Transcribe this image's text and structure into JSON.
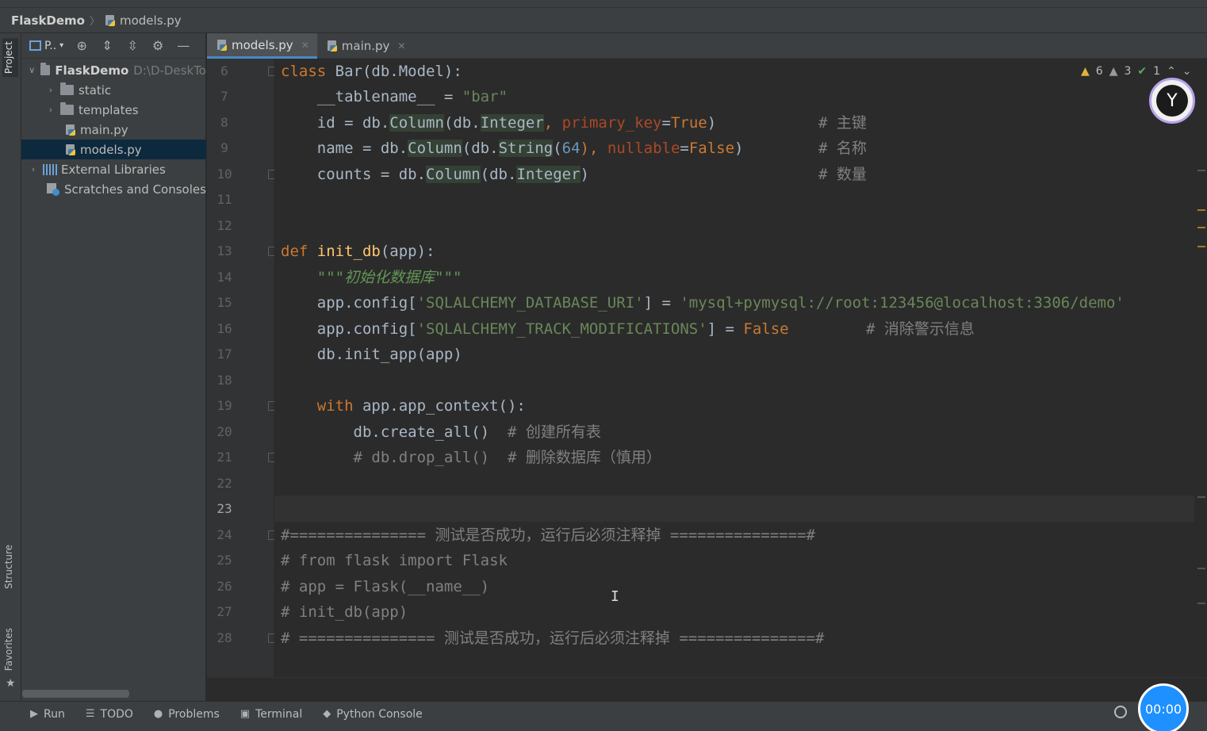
{
  "breadcrumb": {
    "project": "FlaskDemo",
    "file": "models.py"
  },
  "sidestrip": {
    "project": "Project",
    "structure": "Structure",
    "favorites": "Favorites"
  },
  "project_panel": {
    "title": "P..",
    "tree": [
      {
        "label": "FlaskDemo",
        "path": "D:\\D-DeskTo",
        "kind": "root"
      },
      {
        "label": "static",
        "kind": "folder"
      },
      {
        "label": "templates",
        "kind": "folder"
      },
      {
        "label": "main.py",
        "kind": "py"
      },
      {
        "label": "models.py",
        "kind": "py",
        "selected": true
      },
      {
        "label": "External Libraries",
        "kind": "lib"
      },
      {
        "label": "Scratches and Consoles",
        "kind": "scratch"
      }
    ]
  },
  "tabs": [
    {
      "label": "models.py",
      "active": true
    },
    {
      "label": "main.py",
      "active": false
    }
  ],
  "inspections": {
    "warnings": "6",
    "weak": "3",
    "ok": "1"
  },
  "line_numbers": [
    "6",
    "7",
    "8",
    "9",
    "10",
    "11",
    "12",
    "13",
    "14",
    "15",
    "16",
    "17",
    "18",
    "19",
    "20",
    "21",
    "22",
    "23",
    "24",
    "25",
    "26",
    "27",
    "28"
  ],
  "code": {
    "l6": {
      "kw": "class",
      "name": " Bar(db.Model):"
    },
    "l7": {
      "a": "    __tablename__ = ",
      "s": "\"bar\""
    },
    "l8": {
      "a": "    id = db.",
      "h1": "Column",
      "b": "(db.",
      "h2": "Integer",
      "c": ", ",
      "p": "primary_key",
      "d": "=",
      "k": "True",
      "e": ")",
      "cm": "# 主键"
    },
    "l9": {
      "a": "    name = db.",
      "h1": "Column",
      "b": "(db.",
      "h2": "String",
      "c": "(",
      "n": "64",
      "d": "), ",
      "p": "nullable",
      "e": "=",
      "k": "False",
      "f": ")",
      "cm": "# 名称"
    },
    "l10": {
      "a": "    counts = db.",
      "h1": "Column",
      "b": "(db.",
      "h2": "Integer",
      "c": ")",
      "cm": "# 数量"
    },
    "l13": {
      "kw": "def ",
      "fn": "init_db",
      "a": "(app):"
    },
    "l14": {
      "doc": "    \"\"\"初始化数据库\"\"\""
    },
    "l15": {
      "a": "    app.config[",
      "s1": "'SQLALCHEMY_DATABASE_URI'",
      "b": "] = ",
      "s2": "'mysql+pymysql://root:123456@localhost:3306/demo'"
    },
    "l16": {
      "a": "    app.config[",
      "s1": "'SQLALCHEMY_TRACK_MODIFICATIONS'",
      "b": "] = ",
      "k": "False",
      "cm": "# 消除警示信息"
    },
    "l17": {
      "a": "    db.init_app(app)"
    },
    "l19": {
      "kw": "    with ",
      "a": "app.app_context():"
    },
    "l20": {
      "a": "        db.create_all()  ",
      "cm": "# 创建所有表"
    },
    "l21": {
      "cm": "        # db.drop_all()  # 删除数据库（慎用）"
    },
    "l24": {
      "cm": "#=============== 测试是否成功，运行后必须注释掉 ===============#"
    },
    "l25": {
      "cm": "# from flask import Flask"
    },
    "l26": {
      "cm": "# app = Flask(__name__)"
    },
    "l27": {
      "cm": "# init_db(app)"
    },
    "l28": {
      "cm": "# =============== 测试是否成功，运行后必须注释掉 ===============#"
    }
  },
  "bottom_tools": {
    "run": "Run",
    "todo": "TODO",
    "problems": "Problems",
    "terminal": "Terminal",
    "python_console": "Python Console"
  },
  "timer": "00:00"
}
